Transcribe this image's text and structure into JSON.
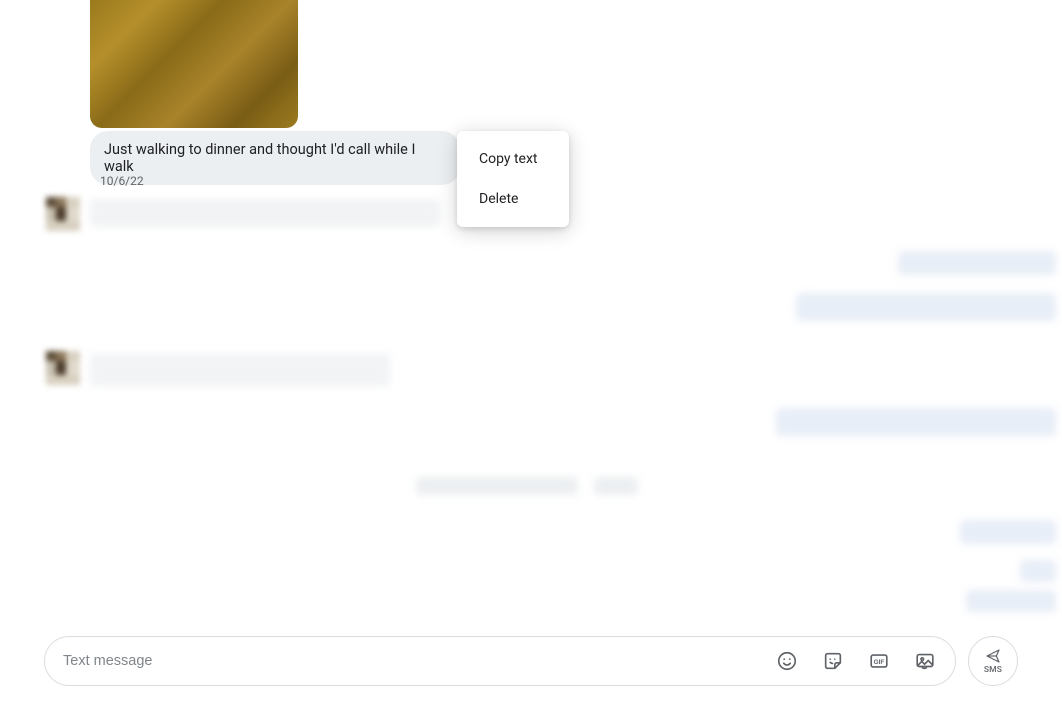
{
  "message": {
    "text": "Just walking to dinner and thought I'd call while I walk",
    "timestamp": "10/6/22"
  },
  "context_menu": {
    "copy_label": "Copy text",
    "delete_label": "Delete"
  },
  "composer": {
    "placeholder": "Text message",
    "send_label": "SMS"
  }
}
